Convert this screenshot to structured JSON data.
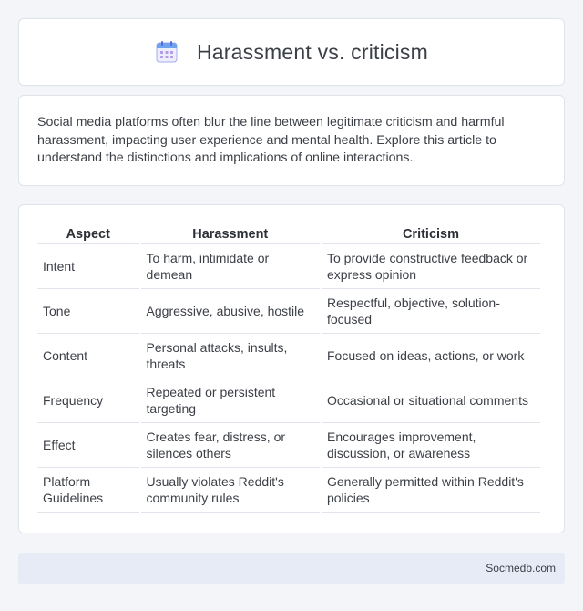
{
  "header": {
    "icon": "calendar-icon",
    "title": "Harassment vs. criticism"
  },
  "intro": {
    "text": "Social media platforms often blur the line between legitimate criticism and harmful harassment, impacting user experience and mental health. Explore this article to understand the distinctions and implications of online interactions."
  },
  "table": {
    "headers": [
      "Aspect",
      "Harassment",
      "Criticism"
    ],
    "rows": [
      [
        "Intent",
        "To harm, intimidate or demean",
        "To provide constructive feedback or express opinion"
      ],
      [
        "Tone",
        "Aggressive, abusive, hostile",
        "Respectful, objective, solution-focused"
      ],
      [
        "Content",
        "Personal attacks, insults, threats",
        "Focused on ideas, actions, or work"
      ],
      [
        "Frequency",
        "Repeated or persistent targeting",
        "Occasional or situational comments"
      ],
      [
        "Effect",
        "Creates fear, distress, or silences others",
        "Encourages improvement, discussion, or awareness"
      ],
      [
        "Platform Guidelines",
        "Usually violates Reddit's community rules",
        "Generally permitted within Reddit's policies"
      ]
    ]
  },
  "footer": {
    "site": "Socmedb.com"
  },
  "colors": {
    "background": "#f3f5f9",
    "card": "#ffffff",
    "footer": "#e6ebf5",
    "icon_accent": "#8b8fe8"
  }
}
